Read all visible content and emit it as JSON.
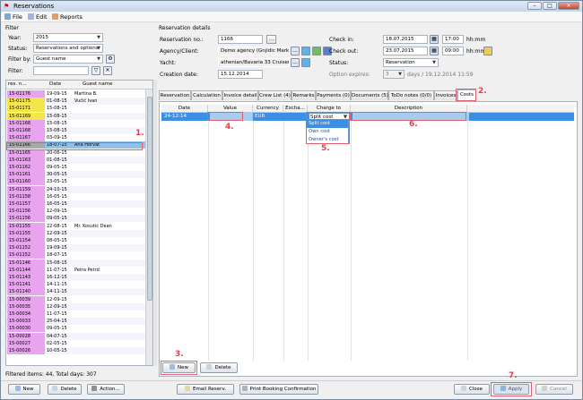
{
  "window": {
    "title": "Reservations",
    "controls": [
      "–",
      "□",
      "✕"
    ]
  },
  "menu": [
    "File",
    "Edit",
    "Reports"
  ],
  "filter": {
    "section_label": "Filter",
    "year_label": "Year:",
    "year_value": "2015",
    "status_label": "Status:",
    "status_value": "Reservations and options",
    "filter_by_label": "Filter by:",
    "filter_by_value": "Guest name",
    "filter_label": "Filter:",
    "filter_value": ""
  },
  "res_grid": {
    "columns": [
      "res. n...",
      "Date",
      "Guest name"
    ],
    "rows": [
      {
        "no": "15-01176",
        "date": "19-09-15",
        "guest": "Martina B.",
        "color": "#e8a4ee"
      },
      {
        "no": "15-01175",
        "date": "01-08-15",
        "guest": "Vučić Ivan",
        "color": "#f4e64a"
      },
      {
        "no": "15-01171",
        "date": "15-08-15",
        "guest": "",
        "color": "#f4e64a"
      },
      {
        "no": "15-01169",
        "date": "15-08-15",
        "guest": "",
        "color": "#f4e64a"
      },
      {
        "no": "15-01168",
        "date": "15-08-15",
        "guest": "",
        "color": "#e8a4ee"
      },
      {
        "no": "15-01168",
        "date": "15-08-15",
        "guest": "",
        "color": "#e8a4ee"
      },
      {
        "no": "15-01167",
        "date": "03-09-15",
        "guest": "",
        "color": "#e8a4ee"
      },
      {
        "no": "15-01166",
        "date": "18-07-15",
        "guest": "Ana Horvat",
        "color": "#a9a9a9"
      },
      {
        "no": "15-01165",
        "date": "20-06-15",
        "guest": "",
        "color": "#e8a4ee"
      },
      {
        "no": "15-01163",
        "date": "01-08-15",
        "guest": "",
        "color": "#e8a4ee"
      },
      {
        "no": "15-01162",
        "date": "09-05-15",
        "guest": "",
        "color": "#e8a4ee"
      },
      {
        "no": "15-01161",
        "date": "30-05-15",
        "guest": "",
        "color": "#e8a4ee"
      },
      {
        "no": "15-01160",
        "date": "23-05-15",
        "guest": "",
        "color": "#e8a4ee"
      },
      {
        "no": "15-01159",
        "date": "24-10-15",
        "guest": "",
        "color": "#e8a4ee"
      },
      {
        "no": "15-01158",
        "date": "16-05-15",
        "guest": "",
        "color": "#e8a4ee"
      },
      {
        "no": "15-01157",
        "date": "16-05-15",
        "guest": "",
        "color": "#e8a4ee"
      },
      {
        "no": "15-01156",
        "date": "12-09-15",
        "guest": "",
        "color": "#e8a4ee"
      },
      {
        "no": "15-01156",
        "date": "09-05-15",
        "guest": "",
        "color": "#e8a4ee"
      },
      {
        "no": "15-01155",
        "date": "22-08-15",
        "guest": "Mr. Kosutic Dean",
        "color": "#e8a4ee"
      },
      {
        "no": "15-01155",
        "date": "12-09-15",
        "guest": "",
        "color": "#e8a4ee"
      },
      {
        "no": "15-01154",
        "date": "08-05-15",
        "guest": "",
        "color": "#e8a4ee"
      },
      {
        "no": "15-01152",
        "date": "19-09-15",
        "guest": "",
        "color": "#e8a4ee"
      },
      {
        "no": "15-01152",
        "date": "18-07-15",
        "guest": "",
        "color": "#e8a4ee"
      },
      {
        "no": "15-01146",
        "date": "15-08-15",
        "guest": "",
        "color": "#e8a4ee"
      },
      {
        "no": "15-01144",
        "date": "11-07-15",
        "guest": "Petra Petrić",
        "color": "#e8a4ee"
      },
      {
        "no": "15-01143",
        "date": "16-12-15",
        "guest": "",
        "color": "#e8a4ee"
      },
      {
        "no": "15-01141",
        "date": "14-11-15",
        "guest": "",
        "color": "#e8a4ee"
      },
      {
        "no": "15-01140",
        "date": "14-11-15",
        "guest": "",
        "color": "#e8a4ee"
      },
      {
        "no": "15-00039",
        "date": "12-09-15",
        "guest": "",
        "color": "#e8a4ee"
      },
      {
        "no": "15-00035",
        "date": "12-09-15",
        "guest": "",
        "color": "#e8a4ee"
      },
      {
        "no": "15-00034",
        "date": "11-07-15",
        "guest": "",
        "color": "#e8a4ee"
      },
      {
        "no": "15-00033",
        "date": "25-04-15",
        "guest": "",
        "color": "#e8a4ee"
      },
      {
        "no": "15-00030",
        "date": "09-05-15",
        "guest": "",
        "color": "#e8a4ee"
      },
      {
        "no": "15-00028",
        "date": "04-07-15",
        "guest": "",
        "color": "#e8a4ee"
      },
      {
        "no": "15-00027",
        "date": "02-05-15",
        "guest": "",
        "color": "#e8a4ee"
      },
      {
        "no": "15-00026",
        "date": "10-05-15",
        "guest": "",
        "color": "#e8a4ee"
      }
    ],
    "selected_index": 7
  },
  "status_text": "Filtered items: 44,  Total days: 307",
  "details": {
    "section_label": "Reservation details",
    "res_no_label": "Reservation no.:",
    "res_no_value": "1166",
    "agency_label": "Agency/Client:",
    "agency_value": "Demo agency (Gnjidic Marko)",
    "yacht_label": "Yacht:",
    "yacht_value": "athenian/Bavaria 33 Cruiser",
    "creation_label": "Creation date:",
    "creation_value": "15.12.2014",
    "checkin_label": "Check in:",
    "checkin_date": "18.07.2015",
    "checkin_time": "17:00",
    "checkin_unit": "hh:mm",
    "checkout_label": "Check out:",
    "checkout_date": "23.07.2015",
    "checkout_time": "09:00",
    "checkout_unit": "hh:mm",
    "status_label": "Status:",
    "status_value": "Reservation",
    "option_label": "Option expires:",
    "option_value": "3",
    "option_suffix": "days / 19.12.2014 11:59"
  },
  "tabs": [
    "Reservation",
    "Calculation",
    "Invoice detail",
    "Crew List (4)",
    "Remarks",
    "Payments (0)",
    "Documents (5)",
    "ToDo notes (0/0)",
    "Invoices",
    "Costs"
  ],
  "costs_grid": {
    "columns": [
      "Date",
      "Value",
      "Currency",
      "Excha...",
      "Charge to",
      "Description"
    ],
    "row": {
      "date": "24-12-14",
      "value": "",
      "currency": "EUR",
      "exchange": "",
      "charge_to": "Split cost",
      "description": ""
    },
    "charge_options": [
      "Split cost",
      "Own cost",
      "Owner's cost"
    ]
  },
  "annotations": [
    "1.",
    "2.",
    "3.",
    "4.",
    "5.",
    "6.",
    "7."
  ],
  "buttons": {
    "new": "New",
    "delete": "Delete",
    "new_cost": "New",
    "delete_cost": "Delete",
    "action": "Action...",
    "email": "Email Reserv.",
    "print": "Print Booking Confirmation",
    "close": "Close",
    "apply": "Apply",
    "cancel": "Cancel"
  }
}
